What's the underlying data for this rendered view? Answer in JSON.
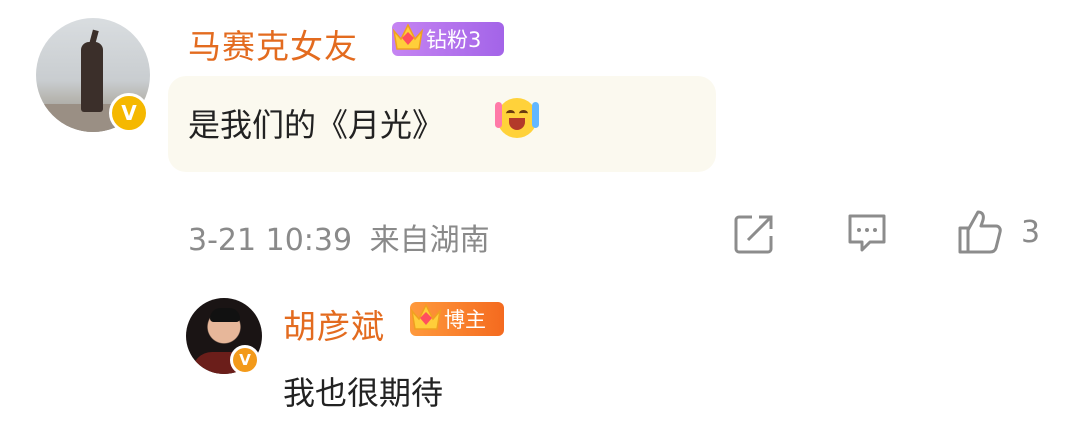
{
  "comment": {
    "user": {
      "name": "马赛克女友",
      "badge": "钻粉3"
    },
    "text": "是我们的《月光》",
    "time": "3-21 10:39",
    "location": "来自湖南",
    "like_count": "3",
    "verified_badge": "V"
  },
  "reply": {
    "user": {
      "name": "胡彦斌",
      "badge": "博主"
    },
    "text": "我也很期待",
    "verified_badge": "V"
  },
  "icons": {
    "share": "share-icon",
    "comment": "comment-icon",
    "like": "thumbs-up-icon",
    "emoji": "laughing-crying-emoji"
  },
  "colors": {
    "username": "#e36b1f",
    "bubble": "#fbf9ef",
    "meta": "#8a8a8a",
    "fan_badge": "#a364e8",
    "host_badge": "#f46a1f",
    "verified_yellow": "#f5b800",
    "verified_orange": "#f39a1a"
  }
}
